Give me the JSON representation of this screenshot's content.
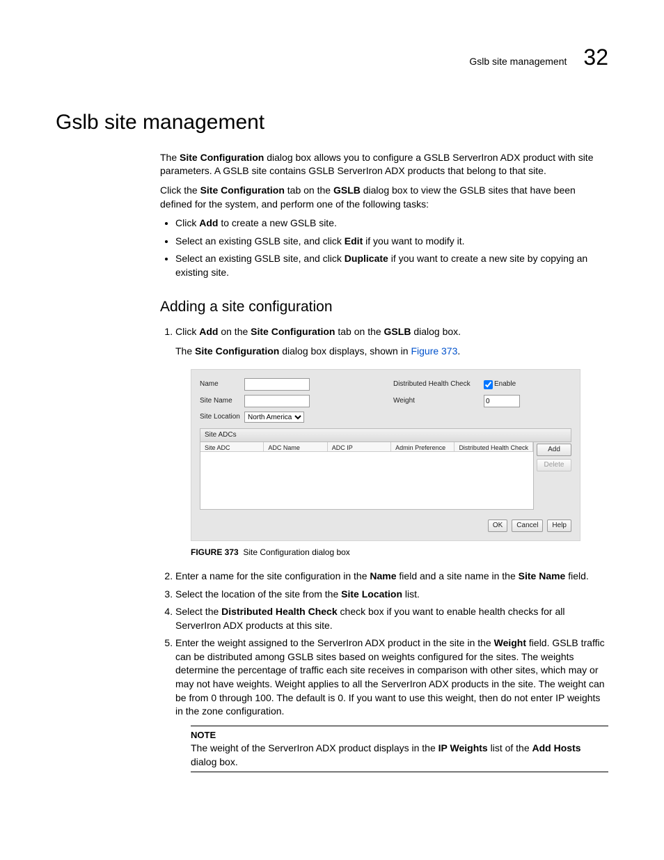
{
  "header": {
    "section": "Gslb site management",
    "chapter": "32"
  },
  "h1": "Gslb site management",
  "intro1a": "The ",
  "intro1b": "Site Configuration",
  "intro1c": " dialog box allows you to configure a GSLB ServerIron ADX product with site parameters. A GSLB site contains GSLB ServerIron ADX products that belong to that site.",
  "intro2a": "Click the ",
  "intro2b": "Site Configuration",
  "intro2c": " tab on the ",
  "intro2d": "GSLB",
  "intro2e": " dialog box to view the GSLB sites that have been defined for the system, and perform one of the following tasks:",
  "bullets": {
    "b1a": "Click ",
    "b1b": "Add",
    "b1c": " to create a new GSLB site.",
    "b2a": "Select an existing GSLB site, and click ",
    "b2b": "Edit",
    "b2c": " if you want to modify it.",
    "b3a": "Select an existing GSLB site, and click ",
    "b3b": "Duplicate",
    "b3c": " if you want to create a new site by copying an existing site."
  },
  "h2": "Adding a site configuration",
  "steps": {
    "s1a": "Click ",
    "s1b": "Add",
    "s1c": " on the ",
    "s1d": "Site Configuration",
    "s1e": " tab on the ",
    "s1f": "GSLB",
    "s1g": " dialog box.",
    "s1sub_a": "The ",
    "s1sub_b": "Site Configuration",
    "s1sub_c": " dialog box displays, shown in ",
    "s1sub_link": "Figure 373",
    "s1sub_d": ".",
    "s2a": "Enter a name for the site configuration in the ",
    "s2b": "Name",
    "s2c": " field and a site name in the ",
    "s2d": "Site Name",
    "s2e": " field.",
    "s3a": "Select the location of the site from the ",
    "s3b": "Site Location",
    "s3c": " list.",
    "s4a": "Select the ",
    "s4b": "Distributed Health Check",
    "s4c": " check box if you want to enable health checks for all ServerIron ADX products at this site.",
    "s5a": "Enter the weight assigned to the ServerIron ADX product in the site in the ",
    "s5b": "Weight",
    "s5c": " field. GSLB traffic can be distributed among GSLB sites based on weights configured for the sites. The weights determine the percentage of traffic each site receives in comparison with other sites, which may or may not have weights. Weight applies to all the ServerIron ADX products in the site. The weight can be from 0 through 100. The default is 0. If you want to use this weight, then do not enter IP weights in the zone configuration."
  },
  "figure": {
    "labels": {
      "name": "Name",
      "siteName": "Site Name",
      "siteLocation": "Site Location",
      "dhc": "Distributed Health Check",
      "enable": "Enable",
      "weight": "Weight"
    },
    "weightValue": "0",
    "locationValue": "North America",
    "panelTitle": "Site ADCs",
    "cols": {
      "c1": "Site ADC",
      "c2": "ADC Name",
      "c3": "ADC IP",
      "c4": "Admin Preference",
      "c5": "Distributed Health Check"
    },
    "sideButtons": {
      "add": "Add",
      "delete": "Delete"
    },
    "bottomButtons": {
      "ok": "OK",
      "cancel": "Cancel",
      "help": "Help"
    },
    "captionPrefix": "FIGURE 373",
    "captionText": "Site Configuration dialog box"
  },
  "note": {
    "title": "NOTE",
    "t1": "The weight of the ServerIron ADX product displays in the ",
    "t2": "IP Weights",
    "t3": " list of the ",
    "t4": "Add Hosts",
    "t5": " dialog box."
  }
}
